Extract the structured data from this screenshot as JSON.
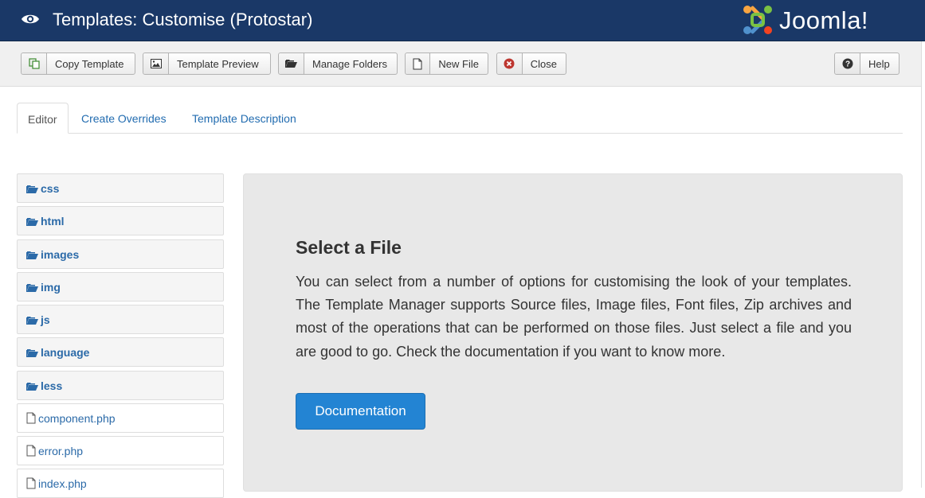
{
  "header": {
    "title": "Templates: Customise (Protostar)",
    "logo_text": "Joomla!",
    "bg_color": "#1a3867"
  },
  "toolbar": {
    "copy_template": "Copy Template",
    "template_preview": "Template Preview",
    "manage_folders": "Manage Folders",
    "new_file": "New File",
    "close": "Close",
    "help": "Help"
  },
  "tabs": {
    "editor": "Editor",
    "create_overrides": "Create Overrides",
    "template_description": "Template Description"
  },
  "tree": {
    "folders": [
      "css",
      "html",
      "images",
      "img",
      "js",
      "language",
      "less"
    ],
    "files": [
      "component.php",
      "error.php",
      "index.php"
    ]
  },
  "main": {
    "heading": "Select a File",
    "body": "You can select from a number of options for customising the look of your templates. The Template Manager supports Source files, Image files, Font files, Zip archives and most of the operations that can be performed on those files. Just select a file and you are good to go. Check the documentation if you want to know more.",
    "doc_button": "Documentation",
    "accent_color": "#2384d3"
  }
}
